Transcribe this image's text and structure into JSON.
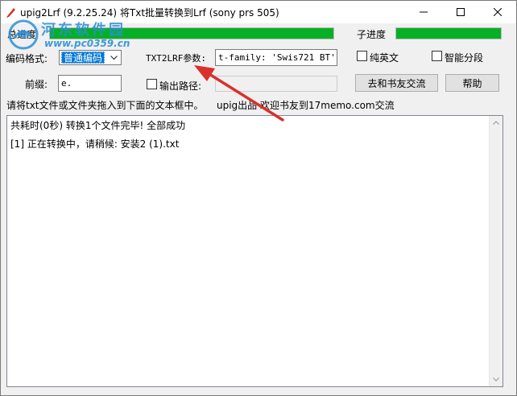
{
  "window": {
    "title": "upig2Lrf (9.2.25.24) 将Txt批量转换到Lrf (sony prs 505)",
    "controls": {
      "minimize": "—",
      "maximize": "☐",
      "close": "✕"
    }
  },
  "watermark": {
    "name": "河东软件园",
    "url": "www.pc0359.cn"
  },
  "progress": {
    "total_label": "总进度",
    "sub_label": "子进度",
    "total_value": 1.0,
    "sub_value": 1.0,
    "color": "#06b025"
  },
  "form": {
    "encoding_label": "编码格式:",
    "encoding_value": "普通编码",
    "txt2lrf_label": "TXT2LRF参数:",
    "txt2lrf_value": "t-family: 'Swis721 BT'}\"",
    "pure_english_label": "纯英文",
    "smart_paragraph_label": "智能分段",
    "prefix_label": "前缀:",
    "prefix_value": "e.",
    "output_path_label": "输出路径:",
    "output_path_value": "",
    "bookfriend_button": "去和书友交流",
    "help_button": "帮助"
  },
  "hint": {
    "drag_text": "请将txt文件或文件夹拖入到下面的文本框中。",
    "credit_text": "upig出品  欢迎书友到17memo.com交流"
  },
  "log": {
    "lines": [
      "共耗时(0秒) 转换1个文件完毕! 全部成功",
      "[1]  正在转换中，请稍候: 安装2 (1).txt"
    ]
  },
  "colors": {
    "accent": "#0078d7",
    "arrow": "#d9302c",
    "watermark": "#2a8fd8"
  }
}
